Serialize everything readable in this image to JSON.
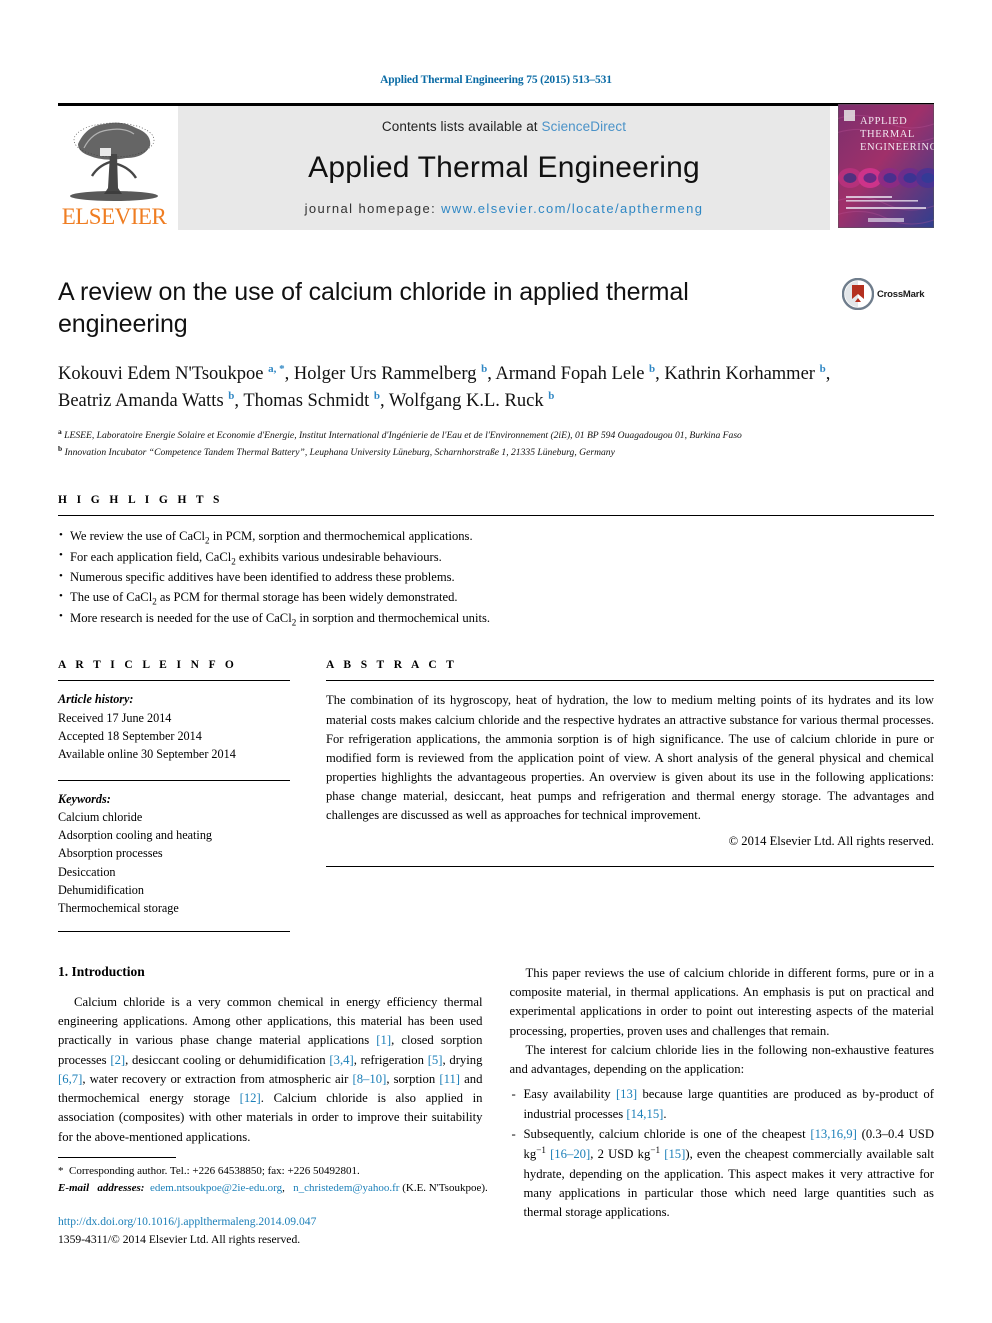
{
  "running_head": "Applied Thermal Engineering 75 (2015) 513–531",
  "masthead": {
    "publisher_logo_text": "ELSEVIER",
    "contents_prefix": "Contents lists available at ",
    "contents_link": "ScienceDirect",
    "journal_name": "Applied Thermal Engineering",
    "homepage_prefix": "journal homepage: ",
    "homepage_url": "www.elsevier.com/locate/apthermeng",
    "cover_title_lines": [
      "APPLIED",
      "THERMAL",
      "ENGINEERING"
    ]
  },
  "article": {
    "title": "A review on the use of calcium chloride in applied thermal engineering",
    "crossmark_label": "CrossMark",
    "authors_line1": "Kokouvi Edem N'Tsoukpoe",
    "authors_html": "Kokouvi Edem N'Tsoukpoe <sup>a, *</sup>, Holger Urs Rammelberg <sup>b</sup>, Armand Fopah Lele <sup>b</sup>, Kathrin Korhammer <sup>b</sup>, Beatriz Amanda Watts <sup>b</sup>, Thomas Schmidt <sup>b</sup>, Wolfgang K.L. Ruck <sup>b</sup>",
    "affiliation_a": "LESEE, Laboratoire Energie Solaire et Economie d'Energie, Institut International d'Ingénierie de l'Eau et de l'Environnement (2iE), 01 BP 594 Ouagadougou 01, Burkina Faso",
    "affiliation_b": "Innovation Incubator “Competence Tandem Thermal Battery”, Leuphana University Lüneburg, Scharnhorstraße 1, 21335 Lüneburg, Germany"
  },
  "highlights": {
    "label": "H I G H L I G H T S",
    "items": [
      "We review the use of CaCl<sub class=\"small\">2</sub> in PCM, sorption and thermochemical applications.",
      "For each application field, CaCl<sub class=\"small\">2</sub> exhibits various undesirable behaviours.",
      "Numerous specific additives have been identified to address these problems.",
      "The use of CaCl<sub class=\"small\">2</sub> as PCM for thermal storage has been widely demonstrated.",
      "More research is needed for the use of CaCl<sub class=\"small\">2</sub> in sorption and thermochemical units."
    ]
  },
  "article_info": {
    "label": "A R T I C L E   I N F O",
    "history_head": "Article history:",
    "history": [
      "Received 17 June 2014",
      "Accepted 18 September 2014",
      "Available online 30 September 2014"
    ],
    "keywords_head": "Keywords:",
    "keywords": [
      "Calcium chloride",
      "Adsorption cooling and heating",
      "Absorption processes",
      "Desiccation",
      "Dehumidification",
      "Thermochemical storage"
    ]
  },
  "abstract": {
    "label": "A B S T R A C T",
    "text": "The combination of its hygroscopy, heat of hydration, the low to medium melting points of its hydrates and its low material costs makes calcium chloride and the respective hydrates an attractive substance for various thermal processes. For refrigeration applications, the ammonia sorption is of high significance. The use of calcium chloride in pure or modified form is reviewed from the application point of view. A short analysis of the general physical and chemical properties highlights the advantageous properties. An overview is given about its use in the following applications: phase change material, desiccant, heat pumps and refrigeration and thermal energy storage. The advantages and challenges are discussed as well as approaches for technical improvement.",
    "copyright": "© 2014 Elsevier Ltd. All rights reserved."
  },
  "body": {
    "section_number_title": "1.  Introduction",
    "left_para_html": "Calcium chloride is a very common chemical in energy efficiency thermal engineering applications. Among other applications, this material has been used practically in various phase change material applications <span class=\"ref\">[1]</span>, closed sorption processes <span class=\"ref\">[2]</span>, desiccant cooling or dehumidification <span class=\"ref\">[3,4]</span>, refrigeration <span class=\"ref\">[5]</span>, drying <span class=\"ref\">[6,7]</span>, water recovery or extraction from atmospheric air <span class=\"ref\">[8–10]</span>, sorption <span class=\"ref\">[11]</span> and thermochemical energy storage <span class=\"ref\">[12]</span>. Calcium chloride is also applied in association (composites) with other materials in order to improve their suitability for the above-mentioned applications.",
    "right_para1": "This paper reviews the use of calcium chloride in different forms, pure or in a composite material, in thermal applications. An emphasis is put on practical and experimental applications in order to point out interesting aspects of the material processing, properties, proven uses and challenges that remain.",
    "right_para2": "The interest for calcium chloride lies in the following non-exhaustive features and advantages, depending on the application:",
    "bullets_html": [
      "Easy availability <span class=\"ref\">[13]</span> because large quantities are produced as by-product of industrial processes <span class=\"ref\">[14,15]</span>.",
      "Subsequently, calcium chloride is one of the cheapest <span class=\"ref\">[13,16,9]</span> (0.3–0.4 USD kg<sup class=\"small\">−1</sup> <span class=\"ref\">[16–20]</span>, 2 USD kg<sup class=\"small\">−1</sup> <span class=\"ref\">[15]</span>), even the cheapest commercially available salt hydrate, depending on the application. This aspect makes it very attractive for many applications in particular those which need large quantities such as thermal storage applications."
    ]
  },
  "footnote": {
    "corresponding_html": "<span class=\"star\">*</span>&nbsp; Corresponding author. Tel.: +226 64538850; fax: +226 50492801.",
    "email_html": "<span class=\"fn-em\">E-mail&nbsp;&nbsp; addresses:</span>&nbsp; <span class=\"mail\">edem.ntsoukpoe@2ie-edu.org</span>,&nbsp;&nbsp; <span class=\"mail\">n_christedem@yahoo.fr</span> (K.E. N'Tsoukpoe).",
    "doi": "http://dx.doi.org/10.1016/j.applthermaleng.2014.09.047",
    "issn_line": "1359-4311/© 2014 Elsevier Ltd. All rights reserved."
  },
  "colors": {
    "running_head_blue": "#0a6ba5",
    "reference_blue": "#1b7fb8",
    "sciencedirect_blue": "#4a92c8",
    "elsevier_orange": "#ef7d22",
    "masthead_gray": "#e8e8e8"
  }
}
